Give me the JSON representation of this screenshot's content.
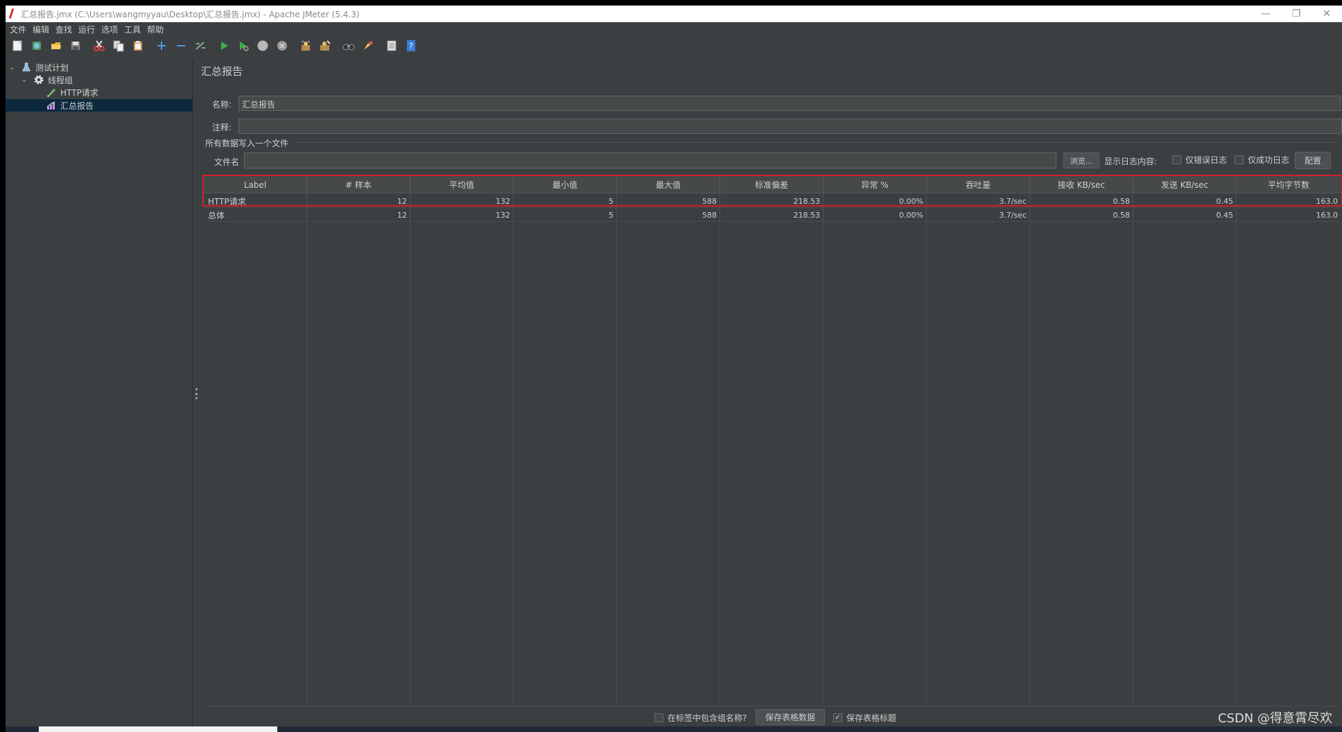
{
  "window": {
    "title": "汇总报告.jmx (C:\\Users\\wangmyyau\\Desktop\\汇总报告.jmx) - Apache JMeter (5.4.3)",
    "controls": {
      "minimize": "—",
      "restore": "❐",
      "close": "✕"
    }
  },
  "menu": [
    "文件",
    "编辑",
    "查找",
    "运行",
    "选项",
    "工具",
    "帮助"
  ],
  "toolbar": {
    "icons": [
      "new-icon",
      "templates-icon",
      "open-icon",
      "save-icon",
      "cut-icon",
      "copy-icon",
      "paste-icon",
      "expand-icon",
      "collapse-icon",
      "toggle-icon",
      "start-icon",
      "start-no-timers-icon",
      "stop-icon",
      "shutdown-icon",
      "clear-icon",
      "clear-all-icon",
      "search-icon",
      "reset-search-icon",
      "function-helper-icon",
      "help-icon"
    ]
  },
  "tree": {
    "items": [
      {
        "label": "测试计划",
        "level": 0,
        "expanded": true,
        "icon": "test-plan-icon"
      },
      {
        "label": "线程组",
        "level": 1,
        "expanded": true,
        "icon": "thread-group-gear-icon"
      },
      {
        "label": "HTTP请求",
        "level": 2,
        "icon": "http-sampler-pen-icon"
      },
      {
        "label": "汇总报告",
        "level": 2,
        "icon": "report-chart-icon",
        "selected": true
      }
    ]
  },
  "panel": {
    "title": "汇总报告",
    "name_label": "名称:",
    "name_value": "汇总报告",
    "comment_label": "注释:",
    "comment_value": "",
    "file_group_label": "所有数据写入一个文件",
    "filename_label": "文件名",
    "filename_value": "",
    "browse_button": "浏览...",
    "log_display_label": "显示日志内容:",
    "errors_only_label": "仅错误日志",
    "errors_only_checked": false,
    "success_only_label": "仅成功日志",
    "success_only_checked": false,
    "configure_button": "配置"
  },
  "table": {
    "columns": [
      "Label",
      "# 样本",
      "平均值",
      "最小值",
      "最大值",
      "标准偏差",
      "异常 %",
      "吞吐量",
      "接收 KB/sec",
      "发送 KB/sec",
      "平均字节数"
    ],
    "rows": [
      [
        "HTTP请求",
        "12",
        "132",
        "5",
        "588",
        "218.53",
        "0.00%",
        "3.7/sec",
        "0.58",
        "0.45",
        "163.0"
      ],
      [
        "总体",
        "12",
        "132",
        "5",
        "588",
        "218.53",
        "0.00%",
        "3.7/sec",
        "0.58",
        "0.45",
        "163.0"
      ]
    ]
  },
  "footer": {
    "include_group_label": "在标签中包含组名称?",
    "include_group_checked": false,
    "save_table_button": "保存表格数据",
    "save_header_label": "保存表格标题",
    "save_header_checked": true
  },
  "watermark": "CSDN @得意霄尽欢",
  "colors": {
    "background": "#3c3f41",
    "selection": "#0d293e",
    "highlight_border": "#d11f2b"
  }
}
